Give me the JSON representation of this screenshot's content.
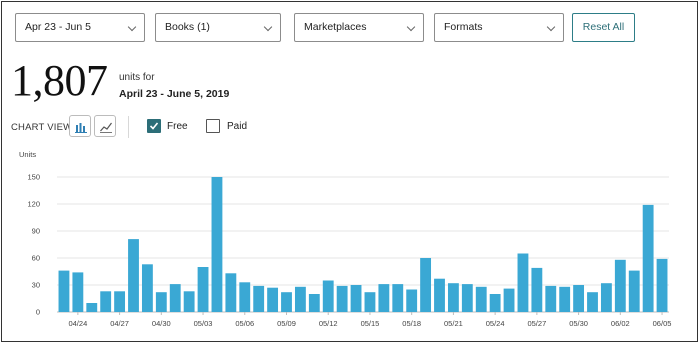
{
  "filters": {
    "date_range": "Apr 23 - Jun 5",
    "books": "Books (1)",
    "marketplaces": "Marketplaces",
    "formats": "Formats",
    "reset_label": "Reset All"
  },
  "summary": {
    "total": "1,807",
    "units_for": "units for",
    "date_range": "April 23 - June 5, 2019"
  },
  "chart_view": {
    "label": "CHART VIEW",
    "bar_icon": "bar-chart-icon",
    "line_icon": "line-chart-icon",
    "free_label": "Free",
    "free_checked": true,
    "paid_label": "Paid",
    "paid_checked": false
  },
  "colors": {
    "bar": "#3aa8d4",
    "accent": "#2c6e78"
  },
  "chart_data": {
    "type": "bar",
    "ylabel": "Units",
    "ylim": [
      0,
      150
    ],
    "yticks": [
      0,
      30,
      60,
      90,
      120,
      150
    ],
    "grid": true,
    "x_tick_labels": [
      "04/24",
      "04/27",
      "04/30",
      "05/03",
      "05/06",
      "05/09",
      "05/12",
      "05/15",
      "05/18",
      "05/21",
      "05/24",
      "05/27",
      "05/30",
      "06/02",
      "06/05"
    ],
    "categories": [
      "04/23",
      "04/24",
      "04/25",
      "04/26",
      "04/27",
      "04/28",
      "04/29",
      "04/30",
      "05/01",
      "05/02",
      "05/03",
      "05/04",
      "05/05",
      "05/06",
      "05/07",
      "05/08",
      "05/09",
      "05/10",
      "05/11",
      "05/12",
      "05/13",
      "05/14",
      "05/15",
      "05/16",
      "05/17",
      "05/18",
      "05/19",
      "05/20",
      "05/21",
      "05/22",
      "05/23",
      "05/24",
      "05/25",
      "05/26",
      "05/27",
      "05/28",
      "05/29",
      "05/30",
      "05/31",
      "06/01",
      "06/02",
      "06/03",
      "06/04",
      "06/05"
    ],
    "values": [
      46,
      44,
      10,
      23,
      23,
      81,
      53,
      22,
      31,
      23,
      50,
      150,
      43,
      33,
      29,
      27,
      22,
      28,
      20,
      35,
      29,
      30,
      22,
      31,
      31,
      25,
      60,
      37,
      32,
      31,
      28,
      20,
      26,
      65,
      49,
      29,
      28,
      30,
      22,
      32,
      58,
      46,
      119,
      59
    ]
  }
}
